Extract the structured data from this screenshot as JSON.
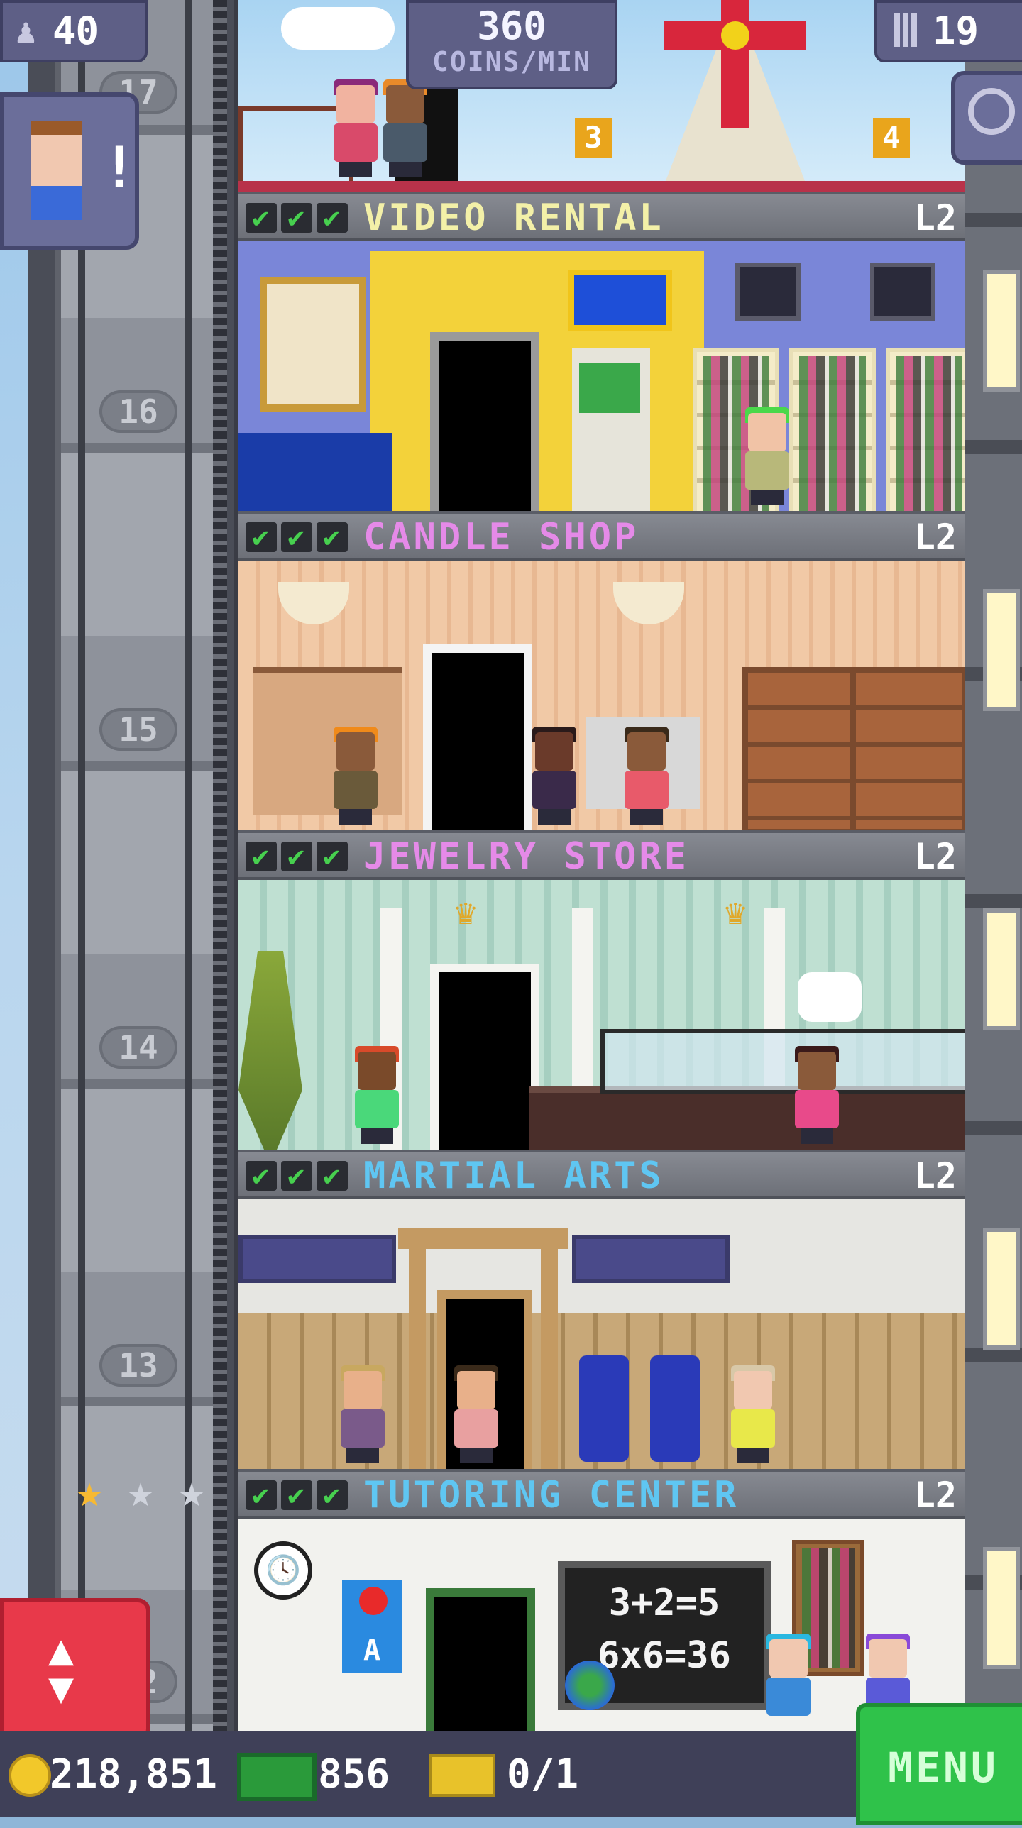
{
  "hud": {
    "population": "40",
    "coins_per_min_value": "360",
    "coins_per_min_label": "COINS/MIN",
    "floors_count": "19",
    "coins": "218,851",
    "bux": "856",
    "tickets": "0/1",
    "menu_label": "MENU"
  },
  "elevator": {
    "floor_numbers": [
      "17",
      "16",
      "15",
      "14",
      "13",
      "12"
    ],
    "stars_filled": 1,
    "stars_total": 3
  },
  "roof": {
    "stop_markers": [
      "3",
      "4"
    ]
  },
  "floors": [
    {
      "name": "VIDEO RENTAL",
      "level": "L2",
      "checks": 3,
      "name_color": "#f3f0a8"
    },
    {
      "name": "CANDLE SHOP",
      "level": "L2",
      "checks": 3,
      "name_color": "#e58ae8"
    },
    {
      "name": "JEWELRY STORE",
      "level": "L2",
      "checks": 3,
      "name_color": "#e58ae8"
    },
    {
      "name": "MARTIAL ARTS",
      "level": "L2",
      "checks": 3,
      "name_color": "#5fc6f2"
    },
    {
      "name": "TUTORING CENTER",
      "level": "L2",
      "checks": 3,
      "name_color": "#5fc6f2"
    }
  ],
  "tutoring": {
    "chalkboard_line1": "3+2=5",
    "chalkboard_line2": "6x6=36",
    "poster_letter": "A"
  },
  "icons": {
    "population": "person-icon",
    "floors": "building-icon",
    "zoom": "magnifier-icon",
    "coins": "coin-icon",
    "bux": "bux-icon",
    "tickets": "ticket-icon",
    "check": "check-icon",
    "quest": "exclamation-icon",
    "elevator": "up-down-arrows-icon"
  }
}
